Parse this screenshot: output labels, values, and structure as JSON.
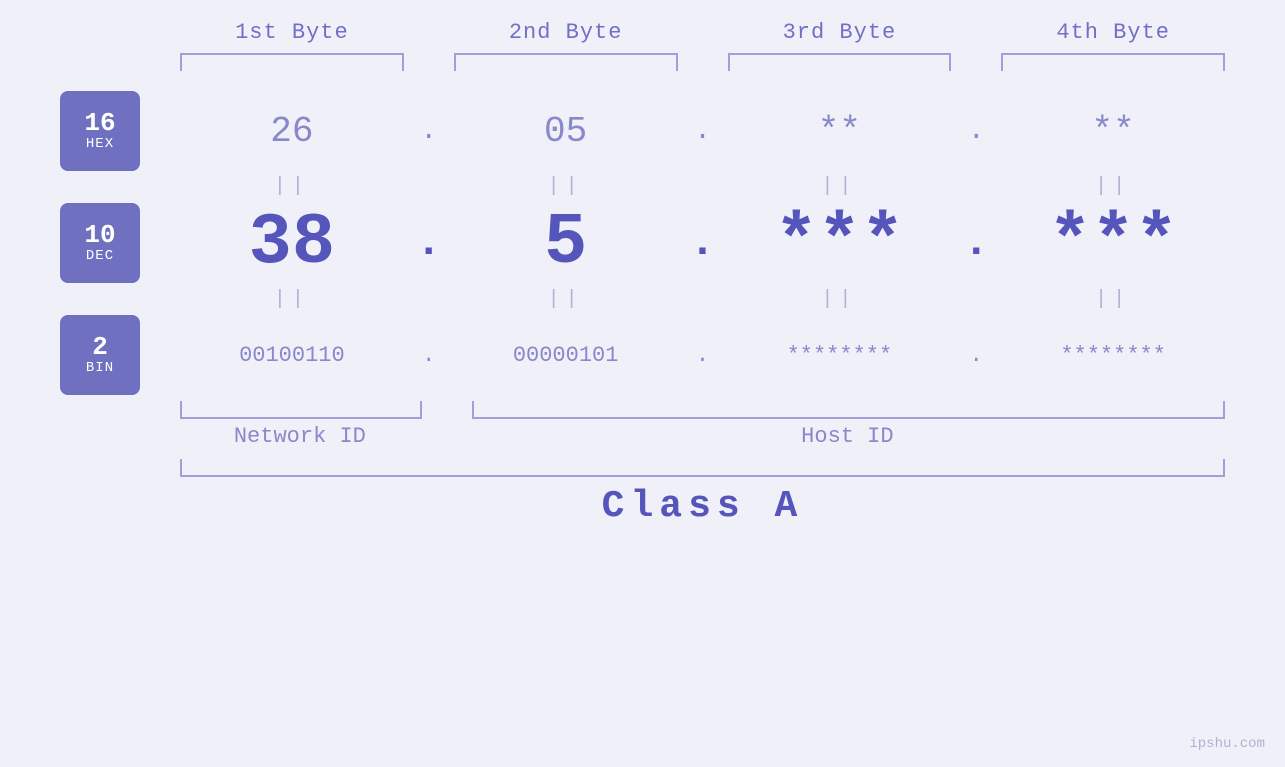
{
  "page": {
    "background": "#f0f0f8",
    "watermark": "ipshu.com"
  },
  "headers": {
    "byte1": "1st Byte",
    "byte2": "2nd Byte",
    "byte3": "3rd Byte",
    "byte4": "4th Byte"
  },
  "badges": {
    "hex": {
      "number": "16",
      "label": "HEX"
    },
    "dec": {
      "number": "10",
      "label": "DEC"
    },
    "bin": {
      "number": "2",
      "label": "BIN"
    }
  },
  "hex_row": {
    "b1": "26",
    "b2": "05",
    "b3": "**",
    "b4": "**",
    "dot": "."
  },
  "dec_row": {
    "b1": "38",
    "b2": "5",
    "b3": "***",
    "b4": "***",
    "dot": "."
  },
  "bin_row": {
    "b1": "00100110",
    "b2": "00000101",
    "b3": "********",
    "b4": "********",
    "dot": "."
  },
  "labels": {
    "network_id": "Network ID",
    "host_id": "Host ID",
    "class": "Class A"
  },
  "equals": "||"
}
